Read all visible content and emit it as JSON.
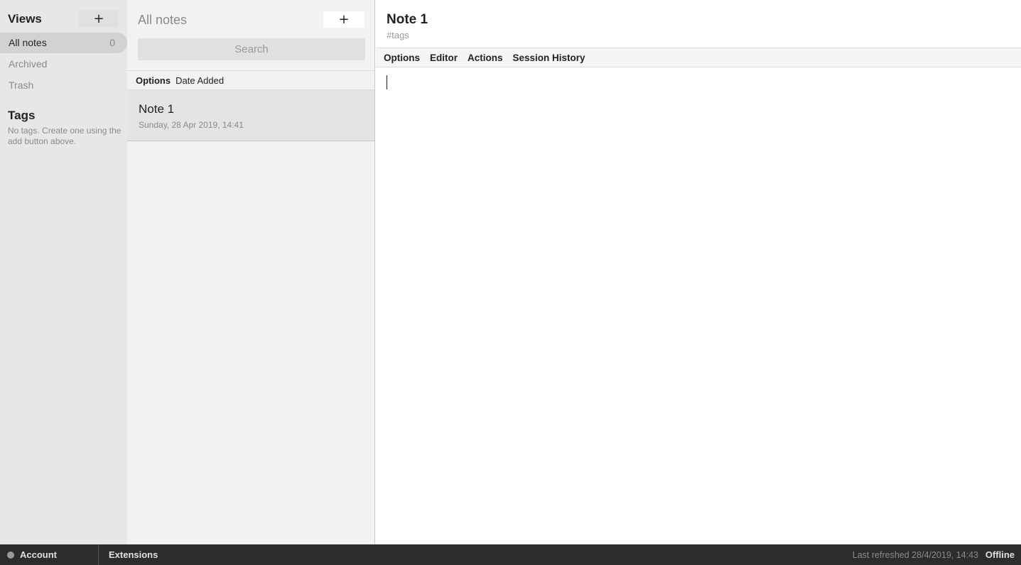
{
  "sidebar": {
    "views_title": "Views",
    "add_symbol": "+",
    "items": [
      {
        "label": "All notes",
        "count": "0"
      },
      {
        "label": "Archived"
      },
      {
        "label": "Trash"
      }
    ],
    "tags_title": "Tags",
    "tags_empty": "No tags. Create one using the add button above."
  },
  "notes": {
    "title": "All notes",
    "add_symbol": "+",
    "search_placeholder": "Search",
    "options_label": "Options",
    "sort_label": "Date Added",
    "list": [
      {
        "title": "Note 1",
        "date": "Sunday, 28 Apr 2019, 14:41"
      }
    ]
  },
  "editor": {
    "title": "Note 1",
    "tags_placeholder": "#tags",
    "menu": [
      "Options",
      "Editor",
      "Actions",
      "Session History"
    ],
    "body": ""
  },
  "footer": {
    "account": "Account",
    "extensions": "Extensions",
    "last_refreshed": "Last refreshed 28/4/2019, 14:43",
    "status": "Offline"
  }
}
